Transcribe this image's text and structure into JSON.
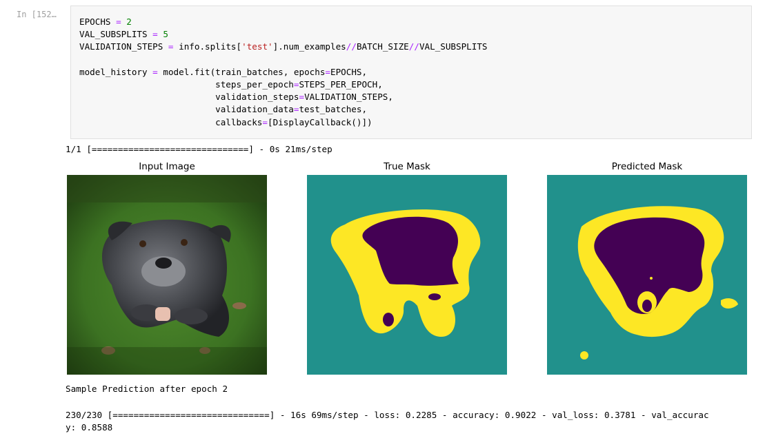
{
  "cell": {
    "prompt": "In [152…",
    "code_lines": {
      "l1": [
        "EPOCHS",
        " ",
        "=",
        " ",
        "2"
      ],
      "l2": [
        "VAL_SUBSPLITS",
        " ",
        "=",
        " ",
        "5"
      ],
      "l3a": "VALIDATION_STEPS",
      "l3b": "info.splits[",
      "l3c": "'test'",
      "l3d": "].num_examples",
      "l3e": "BATCH_SIZE",
      "l3f": "VAL_SUBSPLITS",
      "l5a": "model_history",
      "l5b": "model.fit(train_batches, epochs",
      "l5c": "EPOCHS,",
      "l6a": "steps_per_epoch",
      "l6b": "STEPS_PER_EPOCH,",
      "l7a": "validation_steps",
      "l7b": "VALIDATION_STEPS,",
      "l8a": "validation_data",
      "l8b": "test_batches,",
      "l9a": "callbacks",
      "l9b": "[DisplayCallback()])"
    }
  },
  "output": {
    "progress_line_1": "1/1 [==============================] - 0s 21ms/step",
    "panels": [
      {
        "title": "Input Image"
      },
      {
        "title": "True Mask"
      },
      {
        "title": "Predicted Mask"
      }
    ],
    "caption": "Sample Prediction after epoch 2",
    "progress_line_2a": "230/230 [==============================] - 16s 69ms/step - loss: 0.2285 - accuracy: 0.9022 - val_loss: 0.3781 - val_accurac",
    "progress_line_2b": "y: 0.8588"
  },
  "colors": {
    "mask_background": "#21918c",
    "mask_border": "#fde725",
    "mask_foreground": "#440154"
  }
}
